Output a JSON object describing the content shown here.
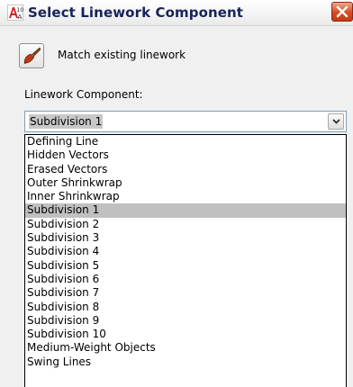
{
  "window": {
    "title": "Select Linework Component",
    "app_icon": "autocad-architecture-icon",
    "close_icon": "close-icon"
  },
  "match_button": {
    "label": "Match existing linework",
    "icon": "brush-icon"
  },
  "linework_component": {
    "label": "Linework Component:",
    "selected_value": "Subdivision 1",
    "arrow_icon": "chevron-down-icon",
    "options": [
      "Defining Line",
      "Hidden Vectors",
      "Erased Vectors",
      "Outer Shrinkwrap",
      "Inner Shrinkwrap",
      "Subdivision 1",
      "Subdivision 2",
      "Subdivision 3",
      "Subdivision 4",
      "Subdivision 5",
      "Subdivision 6",
      "Subdivision 7",
      "Subdivision 8",
      "Subdivision 9",
      "Subdivision 10",
      "Medium-Weight Objects",
      "Swing Lines"
    ],
    "selected_index": 5
  },
  "colors": {
    "title_text": "#17235a",
    "close_button": "#d94a24",
    "selection_highlight": "#c0c0c0",
    "dialog_background": "#f0f0f0"
  }
}
